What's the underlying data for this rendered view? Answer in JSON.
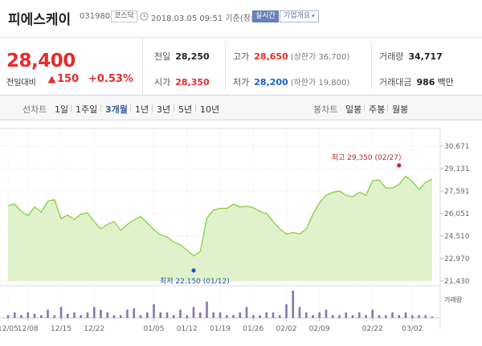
{
  "header": {
    "name": "피에스케이",
    "code": "031980",
    "market": "코스닥",
    "timestamp": "2018.03.05 09:51  기준(장중)",
    "realtime": "실시간",
    "company_btn": "기업개요"
  },
  "quote": {
    "price": "28,400",
    "diff_label": "전일대비",
    "diff_value": "150",
    "diff_rate": "+0.53%",
    "prev_label": "전일",
    "prev_value": "28,250",
    "open_label": "시가",
    "open_value": "28,350",
    "high_label": "고가",
    "high_value": "28,650",
    "high_limit": "(상한가 36,700)",
    "low_label": "저가",
    "low_value": "28,200",
    "low_limit": "(하한가 19,800)",
    "volume_label": "거래량",
    "volume_value": "34,717",
    "amount_label": "거래대금",
    "amount_value": "986",
    "amount_unit": "백만",
    "colors": {
      "up": "#e62b2b",
      "down": "#1a5fd1"
    }
  },
  "tabs": {
    "line_title": "선차트",
    "line": [
      "1일",
      "1주일",
      "3개월",
      "1년",
      "3년",
      "5년",
      "10년"
    ],
    "active": "3개월",
    "candle_title": "봉차트",
    "candle": [
      "일봉",
      "주봉",
      "월봉"
    ]
  },
  "chart_data": {
    "type": "area",
    "y_ticks": [
      "30,671",
      "29,131",
      "27,591",
      "26,051",
      "24,510",
      "22,970",
      "21,430"
    ],
    "ylim": [
      21430,
      30671
    ],
    "x_tick_labels": [
      "12/05",
      "12/08",
      "12/15",
      "12/22",
      "01/05",
      "01/12",
      "01/19",
      "01/26",
      "02/02",
      "02/09",
      "02/22",
      "03/02"
    ],
    "x_tick_index": [
      0,
      3,
      8,
      13,
      22,
      27,
      32,
      37,
      42,
      47,
      55,
      61
    ],
    "price": [
      26600,
      26700,
      26200,
      25900,
      26500,
      26150,
      26900,
      27000,
      25700,
      25950,
      25650,
      26000,
      26100,
      25500,
      25000,
      25300,
      25500,
      24900,
      25300,
      25600,
      25850,
      25400,
      24950,
      24600,
      24450,
      24100,
      23900,
      23550,
      23150,
      23450,
      25750,
      26300,
      26400,
      26400,
      26700,
      26500,
      26550,
      26450,
      26200,
      26050,
      25500,
      25000,
      24650,
      24750,
      24650,
      25000,
      26000,
      26800,
      27300,
      27500,
      27600,
      27300,
      27200,
      27500,
      27300,
      28300,
      28350,
      27800,
      27800,
      28050,
      28600,
      28250,
      27700,
      28200,
      28400
    ],
    "volume": [
      1,
      2,
      1,
      2,
      1.5,
      1,
      3,
      1,
      4,
      1.5,
      2,
      1,
      2,
      4,
      3,
      2,
      1,
      1,
      3,
      3.5,
      1,
      2,
      5,
      2,
      2,
      1,
      3,
      1,
      4,
      2,
      6,
      2,
      2,
      1,
      1,
      2,
      4,
      1,
      1,
      2,
      2,
      1,
      5,
      10,
      4,
      2,
      1,
      2,
      3,
      1,
      1,
      2,
      1,
      2,
      1,
      3,
      1,
      1,
      2,
      1,
      2,
      1,
      1,
      1,
      0.5
    ],
    "high": {
      "label": "최고 29,350 (02/27)",
      "value": 29350,
      "index": 59
    },
    "low": {
      "label": "최저 22,150 (01/12)",
      "value": 22150,
      "index": 28
    },
    "volume_label": "거래량",
    "colors": {
      "line": "#8ed147",
      "fill": "#dff2cc",
      "volume": "#8774b3",
      "high_marker": "#c0262d",
      "low_marker": "#2457b8"
    }
  }
}
